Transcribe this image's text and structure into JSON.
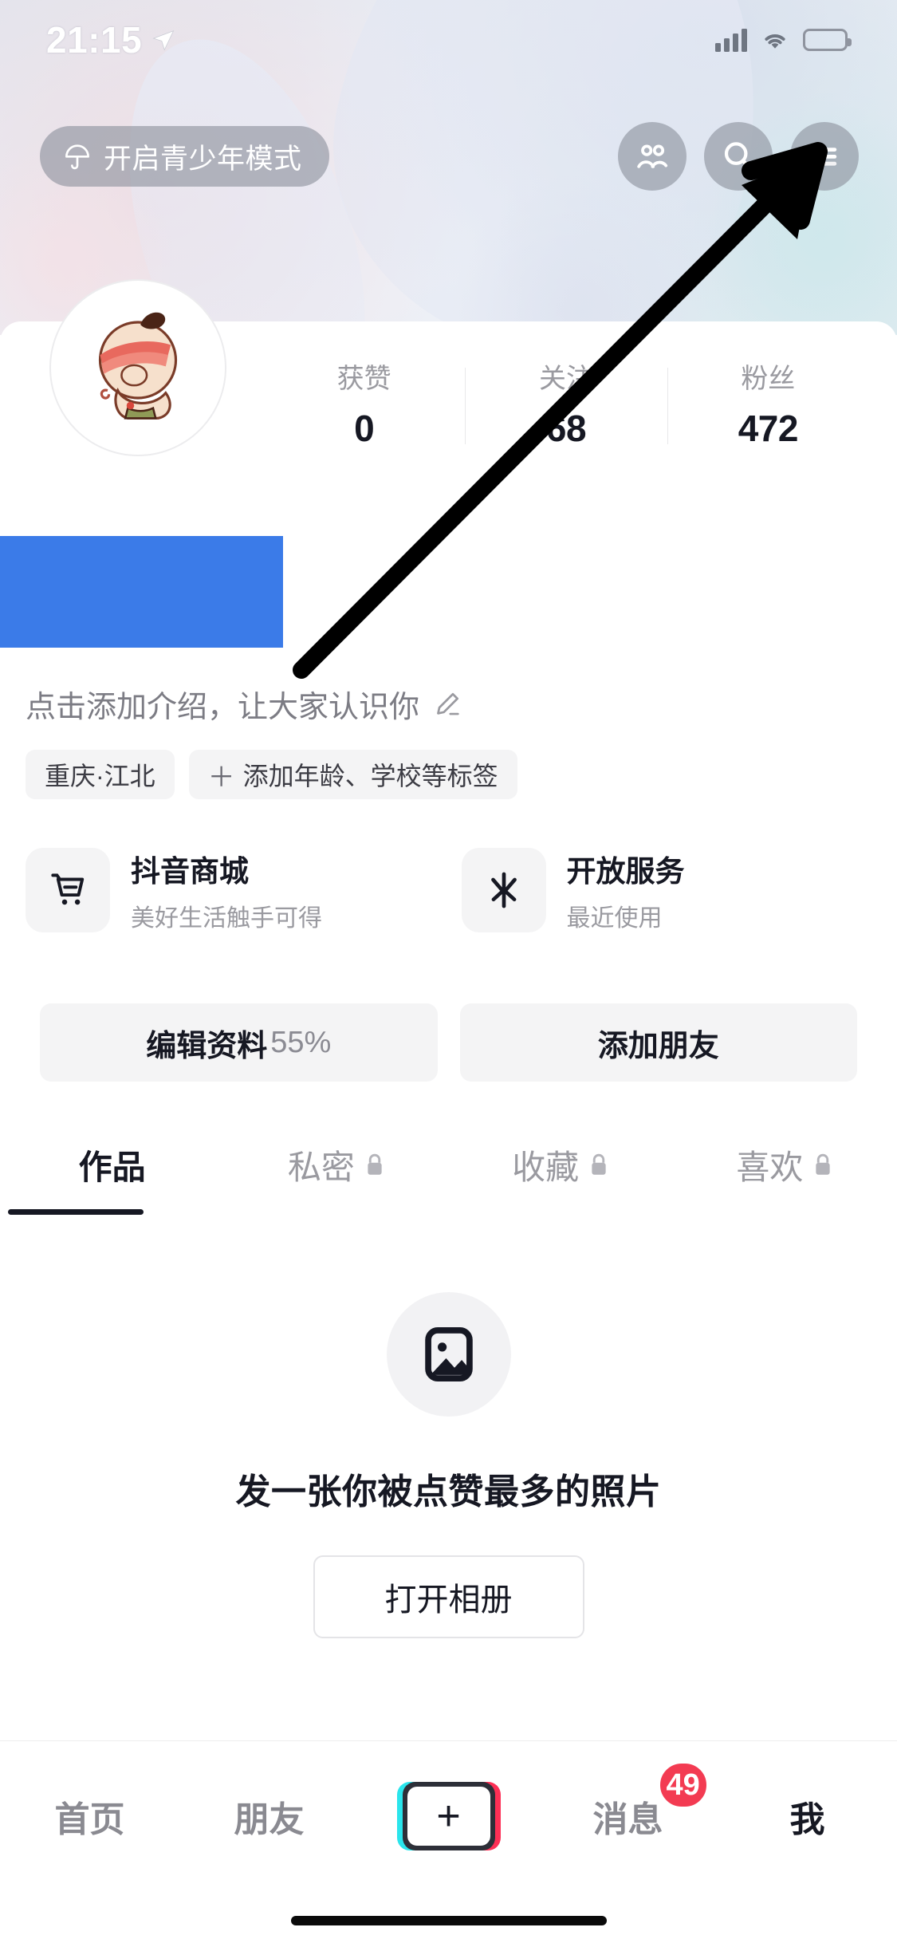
{
  "status_bar": {
    "time": "21:15",
    "location_icon": "location-arrow-icon",
    "signal_icon": "cellular-signal-icon",
    "wifi_icon": "wifi-icon",
    "battery_icon": "battery-low-icon",
    "battery_color": "#f1382f"
  },
  "header": {
    "teen_mode": {
      "label": "开启青少年模式",
      "icon": "umbrella-icon"
    },
    "buttons": [
      {
        "name": "friends-icon"
      },
      {
        "name": "search-icon"
      },
      {
        "name": "menu-icon"
      }
    ]
  },
  "profile": {
    "avatar_icon": "avatar-cartoon-icon",
    "name_redacted": true,
    "redaction_color": "#3B7BE8",
    "stats": [
      {
        "label": "获赞",
        "value": "0"
      },
      {
        "label": "关注",
        "value": "68"
      },
      {
        "label": "粉丝",
        "value": "472"
      }
    ],
    "bio_placeholder": "点击添加介绍，让大家认识你",
    "bio_edit_icon": "pencil-icon",
    "tags": [
      {
        "text": "重庆·江北",
        "has_plus": false
      },
      {
        "text": "添加年龄、学校等标签",
        "has_plus": true,
        "plus": "＋"
      }
    ]
  },
  "service_cards": [
    {
      "title": "抖音商城",
      "subtitle": "美好生活触手可得",
      "icon": "shopping-cart-icon"
    },
    {
      "title": "开放服务",
      "subtitle": "最近使用",
      "icon": "spark-icon"
    }
  ],
  "actions": [
    {
      "label": "编辑资料",
      "percent": "55%"
    },
    {
      "label": "添加朋友",
      "percent": ""
    }
  ],
  "tabs": [
    {
      "label": "作品",
      "locked": false,
      "active": true
    },
    {
      "label": "私密",
      "locked": true,
      "active": false
    },
    {
      "label": "收藏",
      "locked": true,
      "active": false
    },
    {
      "label": "喜欢",
      "locked": true,
      "active": false
    }
  ],
  "empty_state": {
    "icon": "image-placeholder-icon",
    "title": "发一张你被点赞最多的照片",
    "button_label": "打开相册"
  },
  "bottom_nav": {
    "items": [
      {
        "label": "首页",
        "type": "text",
        "active": false
      },
      {
        "label": "朋友",
        "type": "text",
        "active": false
      },
      {
        "label": "+",
        "type": "plus",
        "active": false
      },
      {
        "label": "消息",
        "type": "text",
        "active": false,
        "badge": "49"
      },
      {
        "label": "我",
        "type": "text",
        "active": true
      }
    ]
  },
  "annotation": {
    "type": "arrow",
    "description": "black arrow pointing to menu button"
  }
}
